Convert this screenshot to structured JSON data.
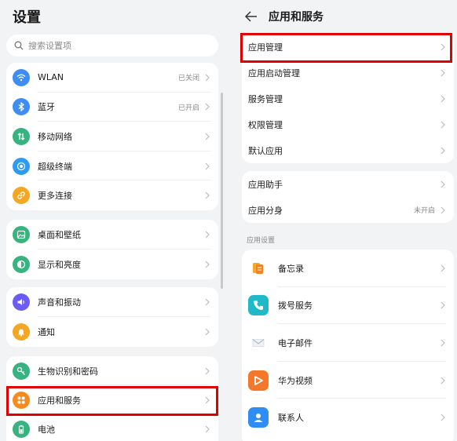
{
  "left": {
    "title": "设置",
    "search_placeholder": "搜索设置项",
    "groups": [
      [
        {
          "label": "WLAN",
          "value": "已关闭",
          "icon": "wifi-icon",
          "color": "#3d8df5"
        },
        {
          "label": "蓝牙",
          "value": "已开启",
          "icon": "bluetooth-icon",
          "color": "#3d8df5"
        },
        {
          "label": "移动网络",
          "value": "",
          "icon": "mobile-network-icon",
          "color": "#36b37e"
        },
        {
          "label": "超级终端",
          "value": "",
          "icon": "super-device-icon",
          "color": "#2e9bf0"
        },
        {
          "label": "更多连接",
          "value": "",
          "icon": "more-connections-icon",
          "color": "#f5a623"
        }
      ],
      [
        {
          "label": "桌面和壁纸",
          "value": "",
          "icon": "wallpaper-icon",
          "color": "#36b37e"
        },
        {
          "label": "显示和亮度",
          "value": "",
          "icon": "display-icon",
          "color": "#36b37e"
        }
      ],
      [
        {
          "label": "声音和振动",
          "value": "",
          "icon": "sound-icon",
          "color": "#6a5cf5"
        },
        {
          "label": "通知",
          "value": "",
          "icon": "notification-icon",
          "color": "#f5a623"
        }
      ],
      [
        {
          "label": "生物识别和密码",
          "value": "",
          "icon": "key-icon",
          "color": "#36b37e"
        },
        {
          "label": "应用和服务",
          "value": "",
          "icon": "apps-icon",
          "color": "#f58a1f"
        },
        {
          "label": "电池",
          "value": "",
          "icon": "battery-icon",
          "color": "#36b37e"
        }
      ]
    ]
  },
  "right": {
    "title": "应用和服务",
    "group1": [
      "应用管理",
      "应用启动管理",
      "服务管理",
      "权限管理",
      "默认应用"
    ],
    "group2": [
      {
        "label": "应用助手",
        "value": ""
      },
      {
        "label": "应用分身",
        "value": "未开启"
      }
    ],
    "section_label": "应用设置",
    "apps": [
      {
        "label": "备忘录",
        "icon": "memo-icon"
      },
      {
        "label": "拨号服务",
        "icon": "phone-icon"
      },
      {
        "label": "电子邮件",
        "icon": "email-icon"
      },
      {
        "label": "华为视频",
        "icon": "video-icon"
      },
      {
        "label": "联系人",
        "icon": "contacts-icon"
      }
    ]
  }
}
